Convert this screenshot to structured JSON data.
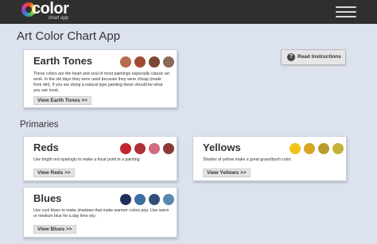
{
  "header": {
    "logo_word": "color",
    "logo_sub": "chart app"
  },
  "page": {
    "title": "Art Color Chart App",
    "section_primaries": "Primaries"
  },
  "read_instructions": {
    "label": "Read Instructions",
    "icon": "?"
  },
  "cards": {
    "earth": {
      "title": "Earth Tones",
      "description": "These colors are the heart and soul of most paintings especially classic art work. In the old days they were used because they were cheap (made from dirt). If you are doing a natural type painting these should be what you use most.",
      "button": "View Earth Tones >>",
      "swatches": [
        "#b56b50",
        "#a34a30",
        "#7a4836",
        "#8c6a58"
      ]
    },
    "reds": {
      "title": "Reds",
      "description": "Use bright red sparingly to make a focal point in a painting",
      "button": "View Reds >>",
      "swatches": [
        "#c1272d",
        "#b03038",
        "#d46a7e",
        "#8b3a3a"
      ]
    },
    "yellows": {
      "title": "Yellows",
      "description": "Shades of yellow make a great grass/bush color.",
      "button": "View Yellows >>",
      "swatches": [
        "#f2c418",
        "#d4a623",
        "#b89b2a",
        "#c3b338"
      ]
    },
    "blues": {
      "title": "Blues",
      "description": "Use cool blues to make shadows that make warmer colors pop. Use warm or medium blue for a day time sky.",
      "button": "View Blues >>",
      "swatches": [
        "#1f2f5a",
        "#3a6fa0",
        "#2f4f7a",
        "#5b86b0"
      ]
    }
  }
}
